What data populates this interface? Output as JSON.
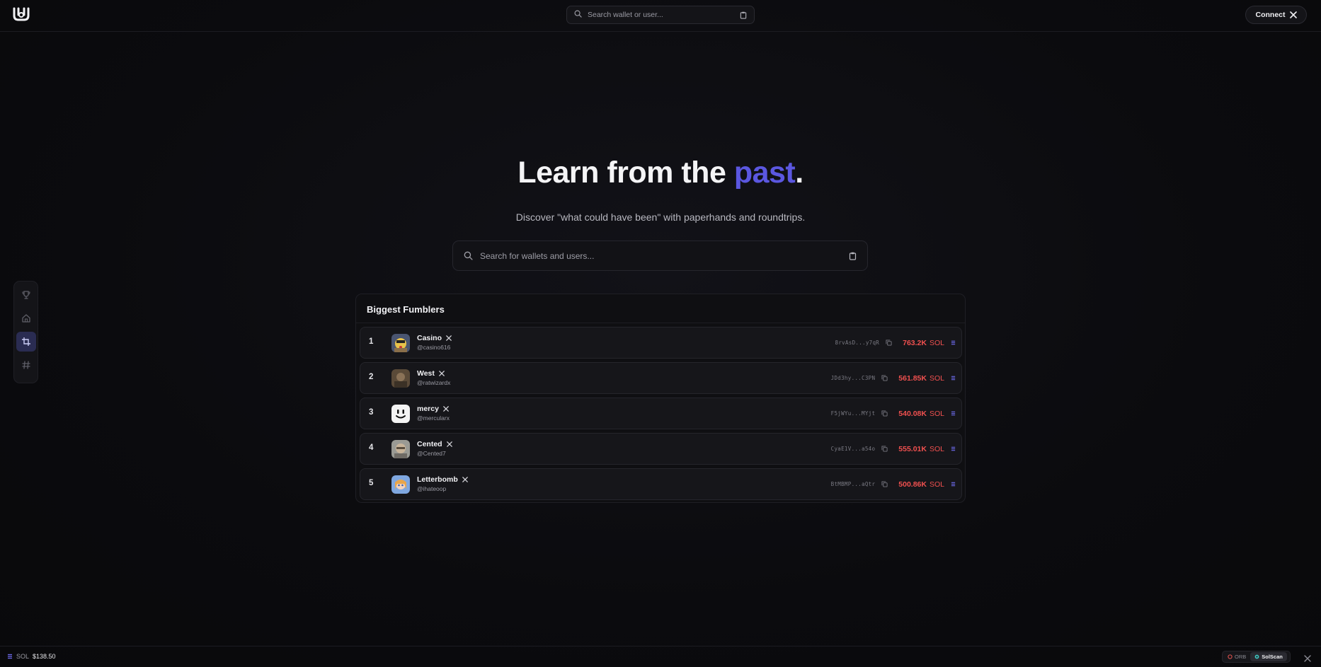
{
  "topbar": {
    "search_placeholder": "Search wallet or user...",
    "connect_label": "Connect"
  },
  "side_nav": {
    "items": [
      {
        "icon": "trophy-icon",
        "active": false
      },
      {
        "icon": "home-icon",
        "active": false
      },
      {
        "icon": "crop-icon",
        "active": true
      },
      {
        "icon": "hash-icon",
        "active": false
      }
    ]
  },
  "hero": {
    "title_main": "Learn from the ",
    "title_accent": "past",
    "title_end": ".",
    "subtitle": "Discover \"what could have been\" with paperhands and roundtrips.",
    "search_placeholder": "Search for wallets and users..."
  },
  "leaderboard": {
    "title": "Biggest Fumblers",
    "rows": [
      {
        "rank": "1",
        "name": "Casino",
        "handle": "@casino616",
        "wallet": "8rvAsD...y7qR",
        "amount": "763.2K",
        "unit": "SOL"
      },
      {
        "rank": "2",
        "name": "West",
        "handle": "@ratwizardx",
        "wallet": "JDd3hy...C3PN",
        "amount": "561.85K",
        "unit": "SOL"
      },
      {
        "rank": "3",
        "name": "mercy",
        "handle": "@mercularx",
        "wallet": "F5jWYu...MYjt",
        "amount": "540.08K",
        "unit": "SOL"
      },
      {
        "rank": "4",
        "name": "Cented",
        "handle": "@Cented7",
        "wallet": "CyaE1V...a54o",
        "amount": "555.01K",
        "unit": "SOL"
      },
      {
        "rank": "5",
        "name": "Letterbomb",
        "handle": "@ihateoop",
        "wallet": "BtMBMP...aQtr",
        "amount": "500.86K",
        "unit": "SOL"
      }
    ]
  },
  "bottombar": {
    "ticker_symbol": "SOL",
    "ticker_price": "$138.50",
    "explorers": [
      {
        "label": "ORB",
        "active": false
      },
      {
        "label": "SolScan",
        "active": true
      }
    ]
  },
  "colors": {
    "accent": "#5b57e0",
    "loss": "#f0504f",
    "background": "#0b0b0e"
  }
}
